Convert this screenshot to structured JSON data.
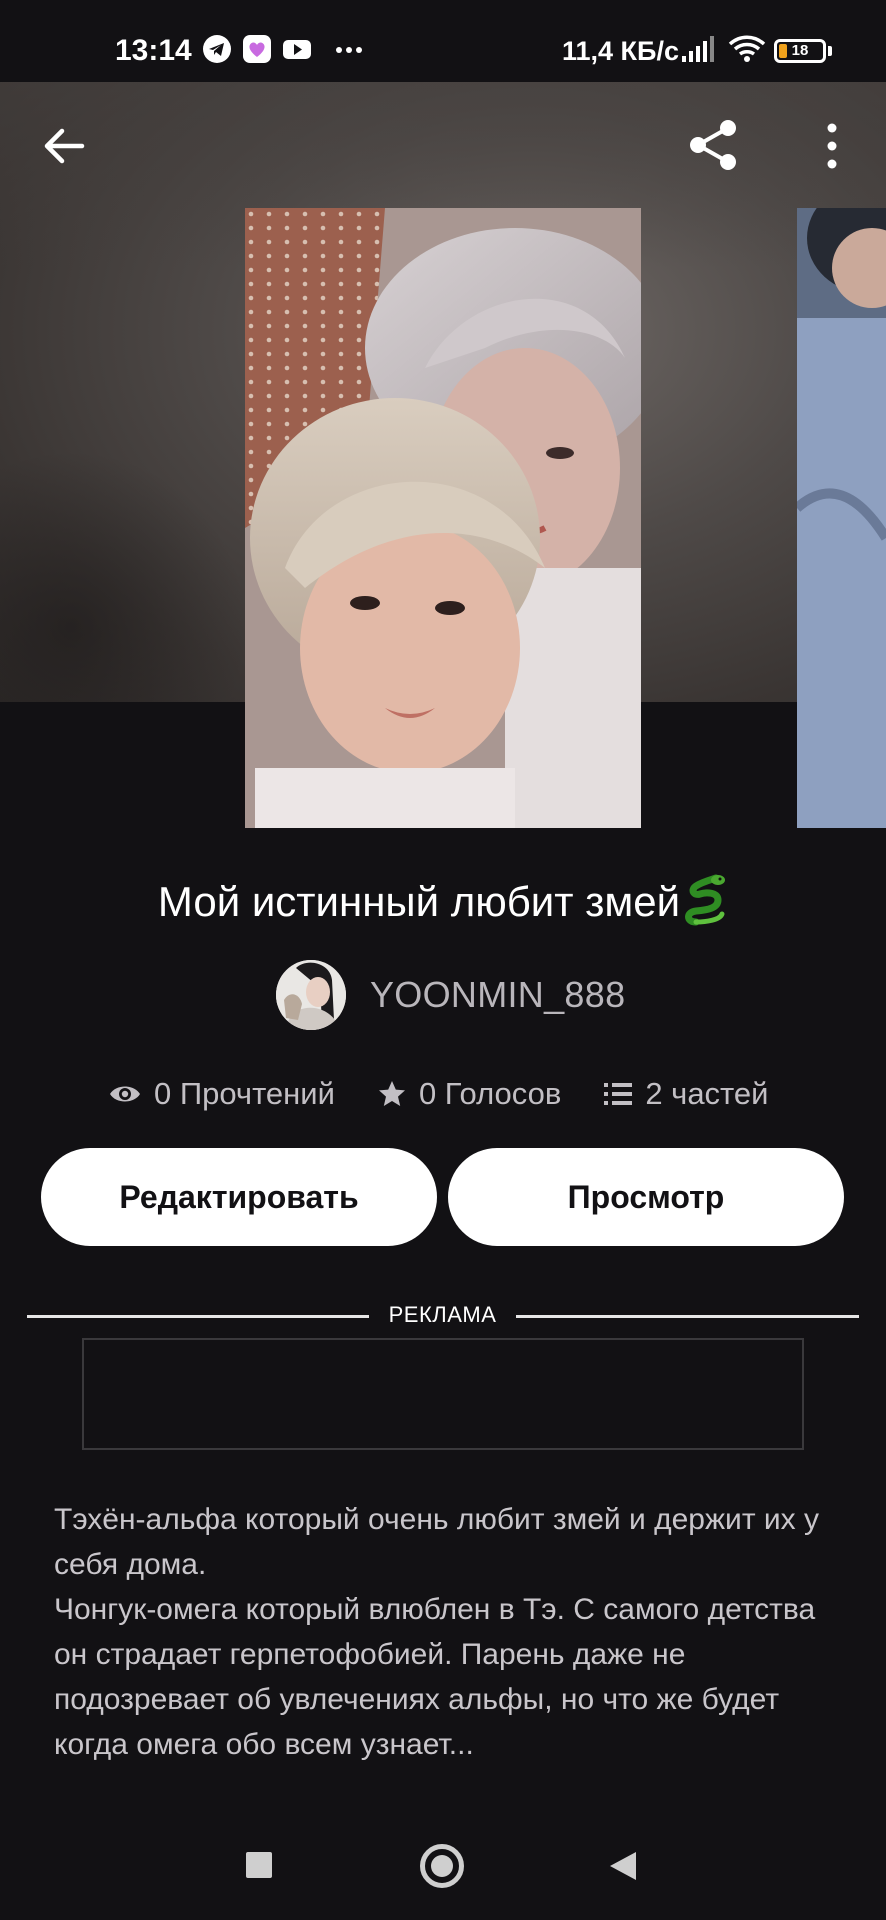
{
  "status_bar": {
    "time": "13:14",
    "network_speed": "11,4 КБ/с",
    "battery_level": "18",
    "battery_fraction": 0.18,
    "icons": [
      "telegram-icon",
      "heart-app-icon",
      "youtube-icon",
      "more-dots-icon",
      "signal-icon",
      "wifi-icon",
      "battery-icon"
    ]
  },
  "header": {
    "icons": [
      "back-arrow-icon",
      "share-icon",
      "more-vertical-icon"
    ]
  },
  "story": {
    "title": "Мой истинный любит змей",
    "title_emoji": "snake-emoji",
    "author": "YOONMIN_888",
    "stats": {
      "reads": "0 Прочтений",
      "votes": "0 Голосов",
      "parts": "2 частей"
    },
    "description": "Тэхён-альфа который очень любит змей и держит их у себя дома.\nЧонгук-омега который влюблен в Тэ. С самого детства он страдает герпетофобией. Парень даже не подозревает об увлечениях альфы, но что же будет когда омега обо всем узнает..."
  },
  "actions": {
    "edit_label": "Редактировать",
    "view_label": "Просмотр"
  },
  "ad": {
    "label": "РЕКЛАМА"
  },
  "colors": {
    "background": "#121114",
    "button_bg": "#ffffff",
    "battery_fill": "#f0a21c",
    "muted_text": "#c2bfc4"
  }
}
